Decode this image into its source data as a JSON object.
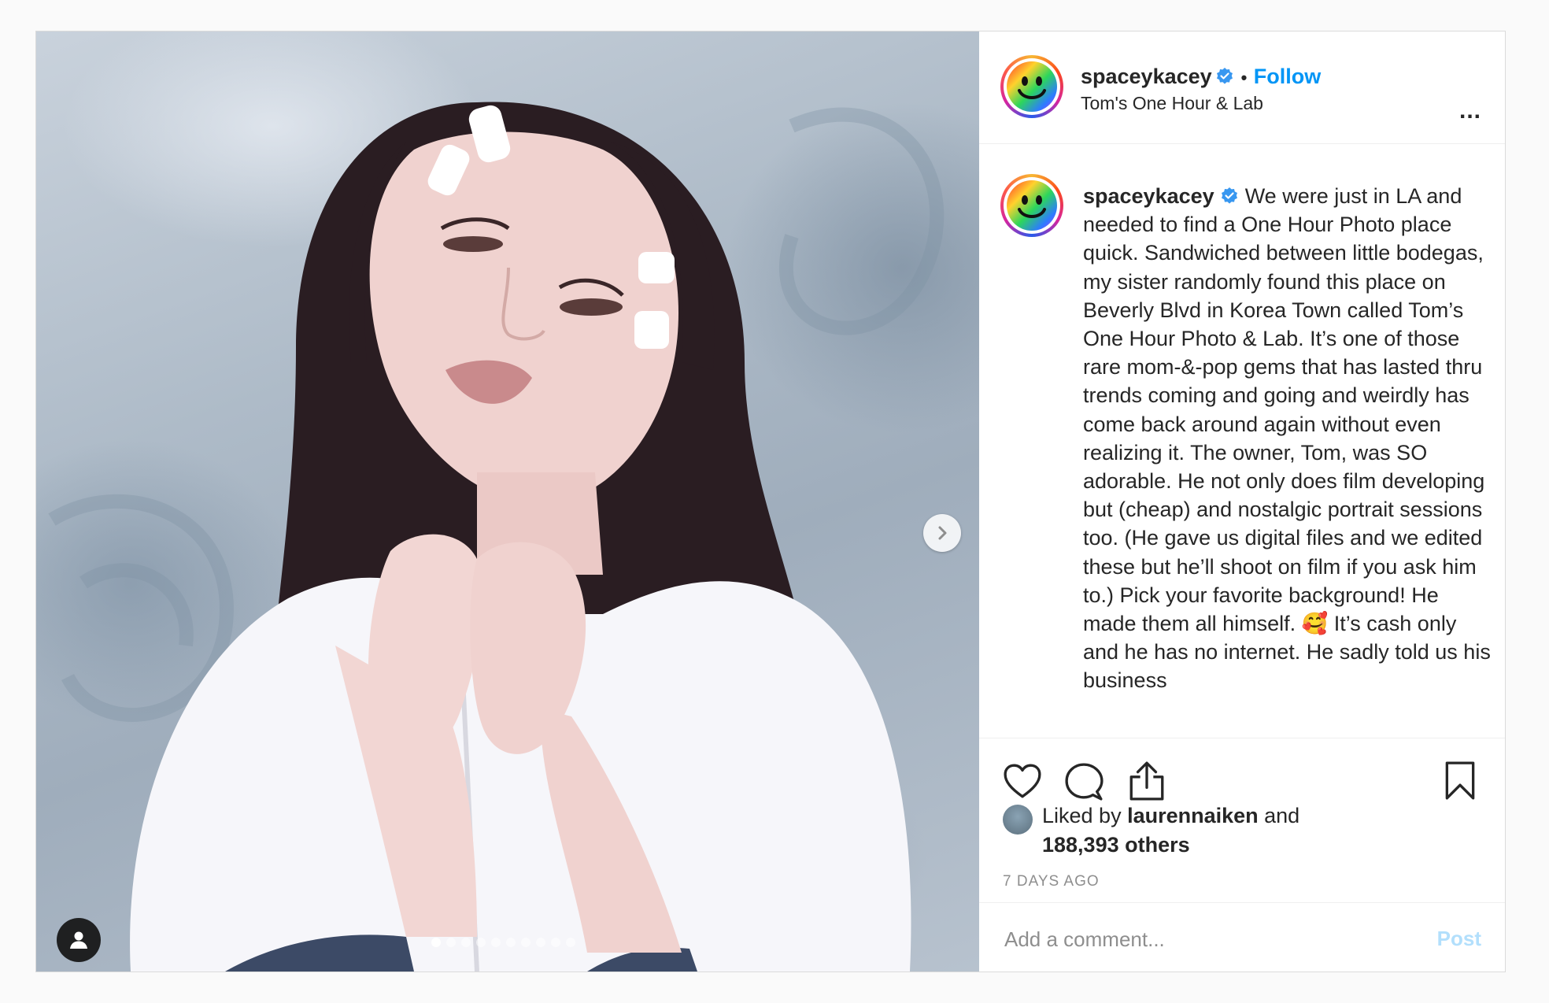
{
  "post": {
    "username": "spaceykacey",
    "verified": true,
    "separator": "•",
    "follow_label": "Follow",
    "location": "Tom's One Hour & Lab",
    "more_label": "...",
    "caption_text": "We were just in LA and needed to find a One Hour Photo place quick. Sandwiched between little bodegas, my sister randomly found this place on Beverly Blvd in Korea Town called Tom’s One Hour Photo & Lab. It’s one of those rare mom-&-pop gems that has lasted thru trends coming and going and weirdly has come back around again without even realizing it. The owner, Tom, was SO adorable. He not only does film developing but (cheap) and nostalgic portrait sessions too. (He gave us digital files and we edited these but he’ll shoot on film if you ask him to.) Pick your favorite background! He made them all himself.",
    "caption_emoji": "🥰",
    "caption_tail": " It’s cash only and he has no internet. He sadly told us his business",
    "likes": {
      "prefix": "Liked by ",
      "user": "laurennaiken",
      "middle": " and",
      "count": "188,393 others"
    },
    "timestamp": "7 DAYS AGO",
    "comment_placeholder": "Add a comment...",
    "post_label": "Post"
  },
  "carousel": {
    "slide_count": 10,
    "active_index": 0
  },
  "icons": {
    "like": "heart-icon",
    "comment": "comment-icon",
    "share": "share-icon",
    "save": "bookmark-icon",
    "next": "chevron-right-icon",
    "tag": "user-tag-icon"
  },
  "colors": {
    "link_blue": "#0095f6",
    "verified_blue": "#3897f0",
    "post_disabled": "#b2dffc",
    "meta_gray": "#8e8e8e"
  }
}
